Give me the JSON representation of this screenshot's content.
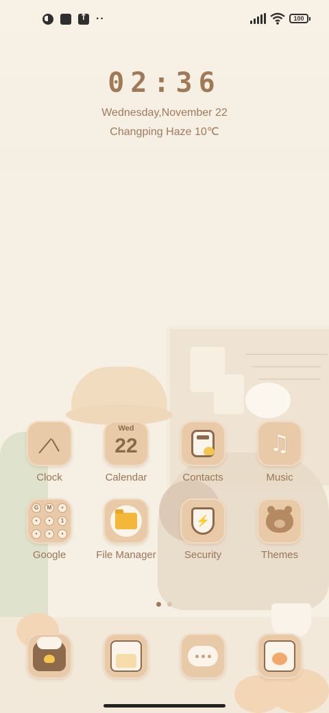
{
  "status_bar": {
    "left_icons": [
      "notification-circle-icon",
      "square-app-icon",
      "upload-icon"
    ],
    "more_indicator": "··",
    "battery": "100"
  },
  "lock_widget": {
    "time": "02:36",
    "date": "Wednesday,November 22",
    "weather": "Changping Haze 10℃"
  },
  "apps": [
    {
      "label": "Clock",
      "icon": "clock-icon"
    },
    {
      "label": "Calendar",
      "icon": "calendar-icon",
      "day": "Wed",
      "date": "22"
    },
    {
      "label": "Contacts",
      "icon": "contacts-icon"
    },
    {
      "label": "Music",
      "icon": "music-icon"
    },
    {
      "label": "Google",
      "icon": "google-folder-icon",
      "folder_letters": [
        "G",
        "M",
        "•",
        "•",
        "•",
        "1",
        "•",
        "•",
        "•"
      ]
    },
    {
      "label": "File Manager",
      "icon": "folder-icon"
    },
    {
      "label": "Security",
      "icon": "shield-icon"
    },
    {
      "label": "Themes",
      "icon": "bear-icon"
    }
  ],
  "pager": {
    "pages": 2,
    "current": 1
  },
  "dock": [
    {
      "icon": "phone-icon"
    },
    {
      "icon": "gallery-icon"
    },
    {
      "icon": "messages-icon"
    },
    {
      "icon": "camera-icon"
    }
  ]
}
